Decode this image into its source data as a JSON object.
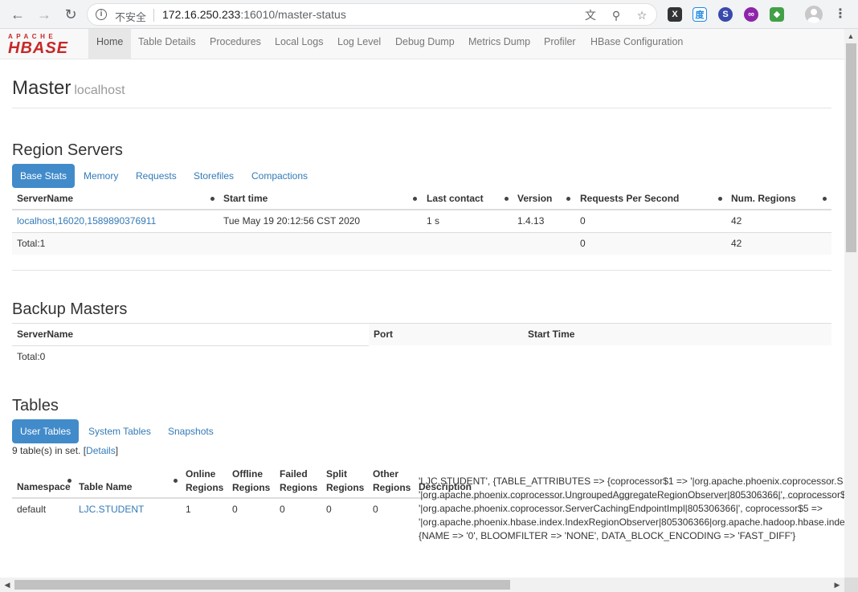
{
  "browser": {
    "security_label": "不安全",
    "url_host": "172.16.250.233",
    "url_rest": ":16010/master-status"
  },
  "logo": {
    "top": "APACHE",
    "main": "HBASE"
  },
  "nav": [
    "Home",
    "Table Details",
    "Procedures",
    "Local Logs",
    "Log Level",
    "Debug Dump",
    "Metrics Dump",
    "Profiler",
    "HBase Configuration"
  ],
  "master": {
    "title": "Master",
    "host": "localhost"
  },
  "region_servers": {
    "title": "Region Servers",
    "tabs": [
      "Base Stats",
      "Memory",
      "Requests",
      "Storefiles",
      "Compactions"
    ],
    "columns": [
      "ServerName",
      "Start time",
      "Last contact",
      "Version",
      "Requests Per Second",
      "Num. Regions"
    ],
    "row": {
      "server": "localhost,16020,1589890376911",
      "start": "Tue May 19 20:12:56 CST 2020",
      "contact": "1 s",
      "version": "1.4.13",
      "rps": "0",
      "regions": "42"
    },
    "total": {
      "label": "Total:1",
      "rps": "0",
      "regions": "42"
    }
  },
  "backup_masters": {
    "title": "Backup Masters",
    "columns": [
      "ServerName",
      "Port",
      "Start Time"
    ],
    "total": "Total:0"
  },
  "tables": {
    "title": "Tables",
    "tabs": [
      "User Tables",
      "System Tables",
      "Snapshots"
    ],
    "count_prefix": "9 table(s) in set. [",
    "details_link": "Details",
    "count_suffix": "]",
    "columns": {
      "namespace": "Namespace",
      "table_name": "Table Name",
      "online_1": "Online",
      "online_2": "Regions",
      "offline_1": "Offline",
      "offline_2": "Regions",
      "failed_1": "Failed",
      "failed_2": "Regions",
      "split_1": "Split",
      "split_2": "Regions",
      "other_1": "Other",
      "other_2": "Regions",
      "description": "Description"
    },
    "row": {
      "namespace": "default",
      "name": "LJC.STUDENT",
      "online": "1",
      "offline": "0",
      "failed": "0",
      "split": "0",
      "other": "0",
      "desc_lines": [
        "'LJC.STUDENT', {TABLE_ATTRIBUTES => {coprocessor$1 => '|org.apache.phoenix.coprocessor.S",
        "'|org.apache.phoenix.coprocessor.UngroupedAggregateRegionObserver|805306366|', coprocessor$",
        "'|org.apache.phoenix.coprocessor.ServerCachingEndpointImpl|805306366|', coprocessor$5 =>",
        "'|org.apache.phoenix.hbase.index.IndexRegionObserver|805306366|org.apache.hadoop.hbase.inde",
        "{NAME => '0', BLOOMFILTER => 'NONE', DATA_BLOCK_ENCODING => 'FAST_DIFF'}"
      ]
    }
  }
}
